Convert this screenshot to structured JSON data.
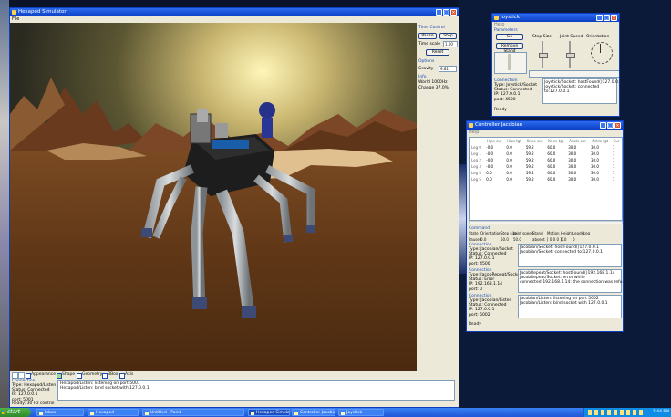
{
  "simulator": {
    "title": "Hexapod Simulator",
    "menu": "File",
    "time_control": {
      "heading": "Time Control",
      "pause": "Pause",
      "step": "Step",
      "time_scale_label": "Time scale",
      "time_scale_value": "1.00",
      "reset": "Reset"
    },
    "options": {
      "heading": "Options",
      "gravity_label": "Gravity",
      "gravity_value": "9.81"
    },
    "info": {
      "heading": "Info",
      "world_rate": "World 1000Hz",
      "change": "Change 37.0%"
    },
    "display_options": [
      "Appearance",
      "Shape",
      "Geometry",
      "BBox",
      "Axis"
    ],
    "connection": {
      "heading": "Connection",
      "details": "Type: Hexapod/Listen\nStatus: Connected\nIP: 127.0.0.1\nport: 5001",
      "log": "Hexapod/Listen: listening on port 5001\nHexapod/Listen: bind socket with 127.0.0.1"
    },
    "status": "Ready: 30 Hz control"
  },
  "joystick": {
    "title": "Joystick",
    "menu": "Help",
    "params_heading": "Parameters",
    "go": "Go",
    "remove_stand": "Remove Stand",
    "step_size": "Step Size",
    "joint_speed": "Joint Speed",
    "orientation": "Orientation",
    "connection": {
      "heading": "Connection",
      "details": "Type: Joystick/Socket\nStatus: Connected\nIP: 127.0.0.1\nport: 4500",
      "log": "Joystick/Socket: hostFound()127.0.0.1\nJoystick/Socket: connected\nto:127.0.0.1"
    },
    "status": "Ready"
  },
  "jacobian": {
    "title": "Controller Jacobian",
    "menu": "Help",
    "columns": [
      "Hips cur",
      "Hips tgt",
      "Knee cur",
      "Knee tgt",
      "Ankle cur",
      "Ankle tgt",
      "Cur"
    ],
    "rows": [
      {
        "leg": "Leg 0",
        "v": [
          "-0.0",
          "0.0",
          "59.2",
          "60.0",
          "30.0",
          "30.0",
          "1"
        ]
      },
      {
        "leg": "Leg 1",
        "v": [
          "-0.0",
          "0.0",
          "59.2",
          "60.0",
          "30.0",
          "30.0",
          "1"
        ]
      },
      {
        "leg": "Leg 2",
        "v": [
          "-0.0",
          "0.0",
          "59.2",
          "60.0",
          "30.0",
          "30.0",
          "1"
        ]
      },
      {
        "leg": "Leg 3",
        "v": [
          "-0.0",
          "0.0",
          "59.2",
          "60.0",
          "30.0",
          "30.0",
          "1"
        ]
      },
      {
        "leg": "Leg 4",
        "v": [
          "0.0",
          "0.0",
          "59.2",
          "60.0",
          "30.0",
          "30.0",
          "1"
        ]
      },
      {
        "leg": "Leg 5",
        "v": [
          "0.0",
          "0.0",
          "59.2",
          "60.0",
          "30.0",
          "30.0",
          "1"
        ]
      }
    ],
    "command": {
      "heading": "Command",
      "headers": [
        "State",
        "Orientation",
        "Step size",
        "Joint speed",
        "Stand",
        "Motion",
        "Height",
        "Leader",
        "Leg"
      ],
      "values": [
        "Paused",
        "0.0",
        "50.0",
        "50.0",
        "absent",
        "[ 0 0 0 ]",
        "0.0",
        "0",
        ""
      ]
    },
    "connections": [
      {
        "details": "Type: Jacobian/Socket\nStatus: Connected\nIP: 127.0.0.1\nport: 4500",
        "log": "Jacobian/Socket: hostFound()127.0.0.1\nJacobian/Socket: connected to:127.0.0.1"
      },
      {
        "details": "Type: JacobRepeat/Socket\nStatus: Error\nIP: 192.168.1.14\nport: 0",
        "log": "JacobRepeat/Socket: hostFound()192.168.1.14\nJacobRepeat/Socket: error while\nconnected(192.168.1.14: the connection was refused)"
      },
      {
        "details": "Type: Jacobian/Listen\nStatus: Connected\nIP: 127.0.0.1\nport: 5002",
        "log": "Jacobian/Listen: listening on port 5002\nJacobian/Listen: bind socket with 127.0.0.1"
      }
    ],
    "conn_heading": "Connection",
    "status": "Ready"
  },
  "taskbar": {
    "start": "start",
    "buttons": [
      "Inbox",
      "Hexapod",
      "Untitled - Paint",
      "Hexapod Simulator",
      "Controller Jacobian",
      "Joystick"
    ],
    "clock": "2:44 PM"
  }
}
